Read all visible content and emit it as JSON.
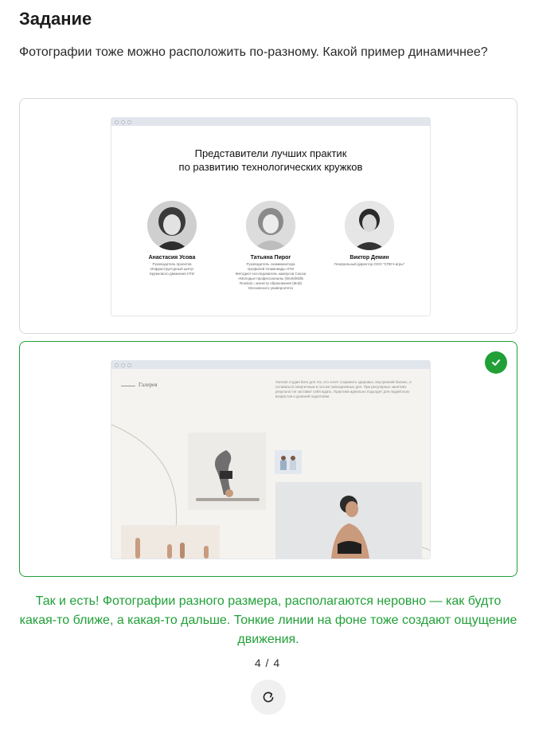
{
  "task": {
    "title": "Задание",
    "question": "Фотографии тоже можно расположить по-разному. Какой пример динамичнее?"
  },
  "options": [
    {
      "id": "a",
      "selected": false,
      "mock": {
        "heading_line1": "Представители лучших практик",
        "heading_line2": "по развитию технологических кружков",
        "people": [
          {
            "name": "Анастасия Усова",
            "desc": [
              "Руководитель проектов",
              "Инфраструктурный центр",
              "Кружкового движения НТИ"
            ]
          },
          {
            "name": "Татьяна Пирог",
            "desc": [
              "Руководитель скоммюнитора",
              "профилей Олимпиады НТИ",
              "Методист-исследователь кампусов Союза",
              "«Молодые профессионалы (WorldSkills",
              "Russia)», магистр образования (Мой)",
              "Московского университета"
            ]
          },
          {
            "name": "Виктор Демин",
            "desc": [
              "Генеральный директор ООО \"СПЕЧ-игры\""
            ]
          }
        ]
      }
    },
    {
      "id": "b",
      "selected": true,
      "mock": {
        "gallery_label": "Галерея",
        "gallery_text": "Уютная студия йоги для тех, кто хочет сохранить здоровье, внутренний баланс, и оставаться энергичным в потоке повседневных дел. При регулярных занятиях результат не заставит себя ждать. Практики идеально подходят для людей всех возрастов и уровней подготовки."
      }
    }
  ],
  "feedback": "Так и есть! Фотографии разного размера, располагаются неровно — как будто какая-то ближе, а какая-то дальше. Тонкие линии на фоне тоже создают ощущение движения.",
  "progress": "4 / 4",
  "colors": {
    "accent_green": "#21a038",
    "option_border": "#d9d9d9"
  },
  "icons": {
    "selected": "check-icon",
    "reset": "refresh-icon"
  }
}
